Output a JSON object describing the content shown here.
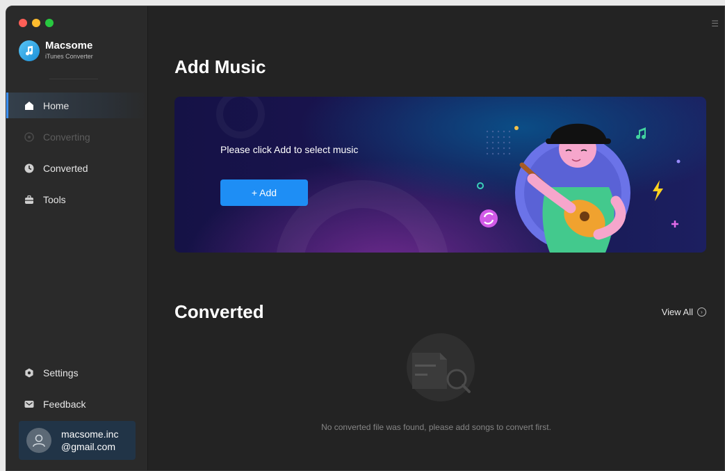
{
  "app": {
    "name": "Macsome",
    "subtitle": "iTunes Converter"
  },
  "sidebar": {
    "items": [
      {
        "label": "Home",
        "icon": "home-icon",
        "state": "active"
      },
      {
        "label": "Converting",
        "icon": "converting-icon",
        "state": "disabled"
      },
      {
        "label": "Converted",
        "icon": "clock-icon",
        "state": "normal"
      },
      {
        "label": "Tools",
        "icon": "toolbox-icon",
        "state": "normal"
      }
    ],
    "bottom": [
      {
        "label": "Settings",
        "icon": "gear-icon"
      },
      {
        "label": "Feedback",
        "icon": "mail-icon"
      }
    ],
    "user": {
      "email_line1": "macsome.inc",
      "email_line2": "@gmail.com"
    }
  },
  "main": {
    "add_music": {
      "title": "Add Music",
      "prompt": "Please click Add to select music",
      "button": "+ Add"
    },
    "converted": {
      "title": "Converted",
      "view_all": "View All",
      "empty_message": "No converted file was found, please add songs to convert first."
    }
  },
  "colors": {
    "accent": "#1e8ef5",
    "sidebar_bg": "#2a2a2a",
    "main_bg": "#232323"
  }
}
